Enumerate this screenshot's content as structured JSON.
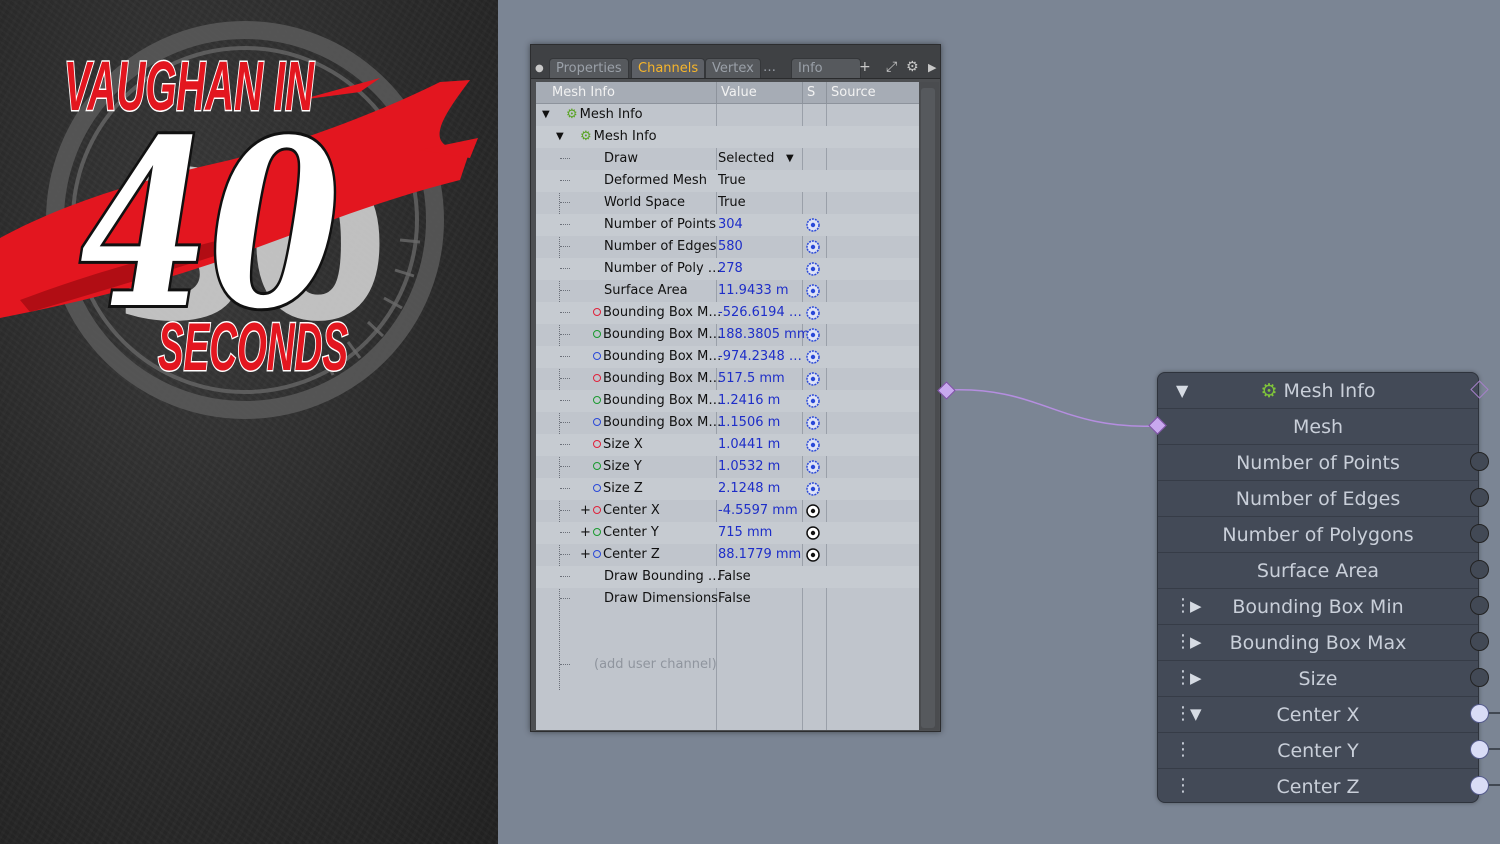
{
  "logo": {
    "line1": "VAUGHAN IN",
    "number": "40",
    "line3": "SECONDS"
  },
  "channels_panel": {
    "tabs": [
      "Properties",
      "Channels",
      "Vertex",
      "…",
      "Info"
    ],
    "active_tab": "Channels",
    "toolbar_icons": [
      "add-icon",
      "expand-icon",
      "gear-icon",
      "arrow-right-icon"
    ],
    "columns": {
      "name": "Mesh Info",
      "value": "Value",
      "s": "S",
      "source": "Source"
    },
    "tree_root": "Mesh Info",
    "tree_child": "Mesh Info",
    "rows": [
      {
        "name": "Draw",
        "value": "Selected",
        "dropdown": true
      },
      {
        "name": "Deformed Mesh",
        "value": "True"
      },
      {
        "name": "World Space",
        "value": "True"
      },
      {
        "name": "Number of Points",
        "value": "304",
        "numeric": true,
        "s": "gear"
      },
      {
        "name": "Number of Edges",
        "value": "580",
        "numeric": true,
        "s": "gear"
      },
      {
        "name": "Number of Poly …",
        "value": "278",
        "numeric": true,
        "s": "gear"
      },
      {
        "name": "Surface Area",
        "value": "11.9433 m",
        "numeric": true,
        "s": "gear"
      },
      {
        "name": "Bounding Box M…",
        "value": "-526.6194 …",
        "numeric": true,
        "s": "gear",
        "dot": "r"
      },
      {
        "name": "Bounding Box M…",
        "value": "188.3805 mm",
        "numeric": true,
        "s": "gear",
        "dot": "g"
      },
      {
        "name": "Bounding Box M…",
        "value": "-974.2348 …",
        "numeric": true,
        "s": "gear",
        "dot": "b"
      },
      {
        "name": "Bounding Box M…",
        "value": "517.5 mm",
        "numeric": true,
        "s": "gear",
        "dot": "r"
      },
      {
        "name": "Bounding Box M…",
        "value": "1.2416 m",
        "numeric": true,
        "s": "gear",
        "dot": "g"
      },
      {
        "name": "Bounding Box M…",
        "value": "1.1506 m",
        "numeric": true,
        "s": "gear",
        "dot": "b"
      },
      {
        "name": "Size X",
        "value": "1.0441 m",
        "numeric": true,
        "s": "gear",
        "dot": "r"
      },
      {
        "name": "Size Y",
        "value": "1.0532 m",
        "numeric": true,
        "s": "gear",
        "dot": "g"
      },
      {
        "name": "Size Z",
        "value": "2.1248 m",
        "numeric": true,
        "s": "gear",
        "dot": "b"
      },
      {
        "name": "Center X",
        "value": "-4.5597 mm",
        "numeric": true,
        "s": "link",
        "dot": "r",
        "expand": true
      },
      {
        "name": "Center Y",
        "value": "715 mm",
        "numeric": true,
        "s": "link",
        "dot": "g",
        "expand": true
      },
      {
        "name": "Center Z",
        "value": "88.1779 mm",
        "numeric": true,
        "s": "link",
        "dot": "b",
        "expand": true
      },
      {
        "name": "Draw Bounding …",
        "value": "False"
      },
      {
        "name": "Draw Dimensions",
        "value": "False"
      }
    ],
    "add_user_channel": "(add user channel)"
  },
  "node": {
    "title": "Mesh Info",
    "input": "Mesh",
    "outputs": [
      {
        "label": "Number of Points"
      },
      {
        "label": "Number of Edges"
      },
      {
        "label": "Number of Polygons"
      },
      {
        "label": "Surface Area"
      },
      {
        "label": "Bounding Box Min",
        "grip": true,
        "expander": "collapsed"
      },
      {
        "label": "Bounding Box Max",
        "grip": true,
        "expander": "collapsed"
      },
      {
        "label": "Size",
        "grip": true,
        "expander": "collapsed"
      },
      {
        "label": "Center X",
        "grip": true,
        "expander": "expanded",
        "connected": true
      },
      {
        "label": "Center Y",
        "grip": true,
        "connected": true
      },
      {
        "label": "Center Z",
        "grip": true,
        "connected": true
      }
    ]
  },
  "colors": {
    "canvas": "#7b8594",
    "active_tab": "#f7b52a",
    "numeric_value": "#1e2ec8",
    "wire": "#b58ee0",
    "node_body": "#434a57",
    "logo_red": "#e3161f"
  }
}
